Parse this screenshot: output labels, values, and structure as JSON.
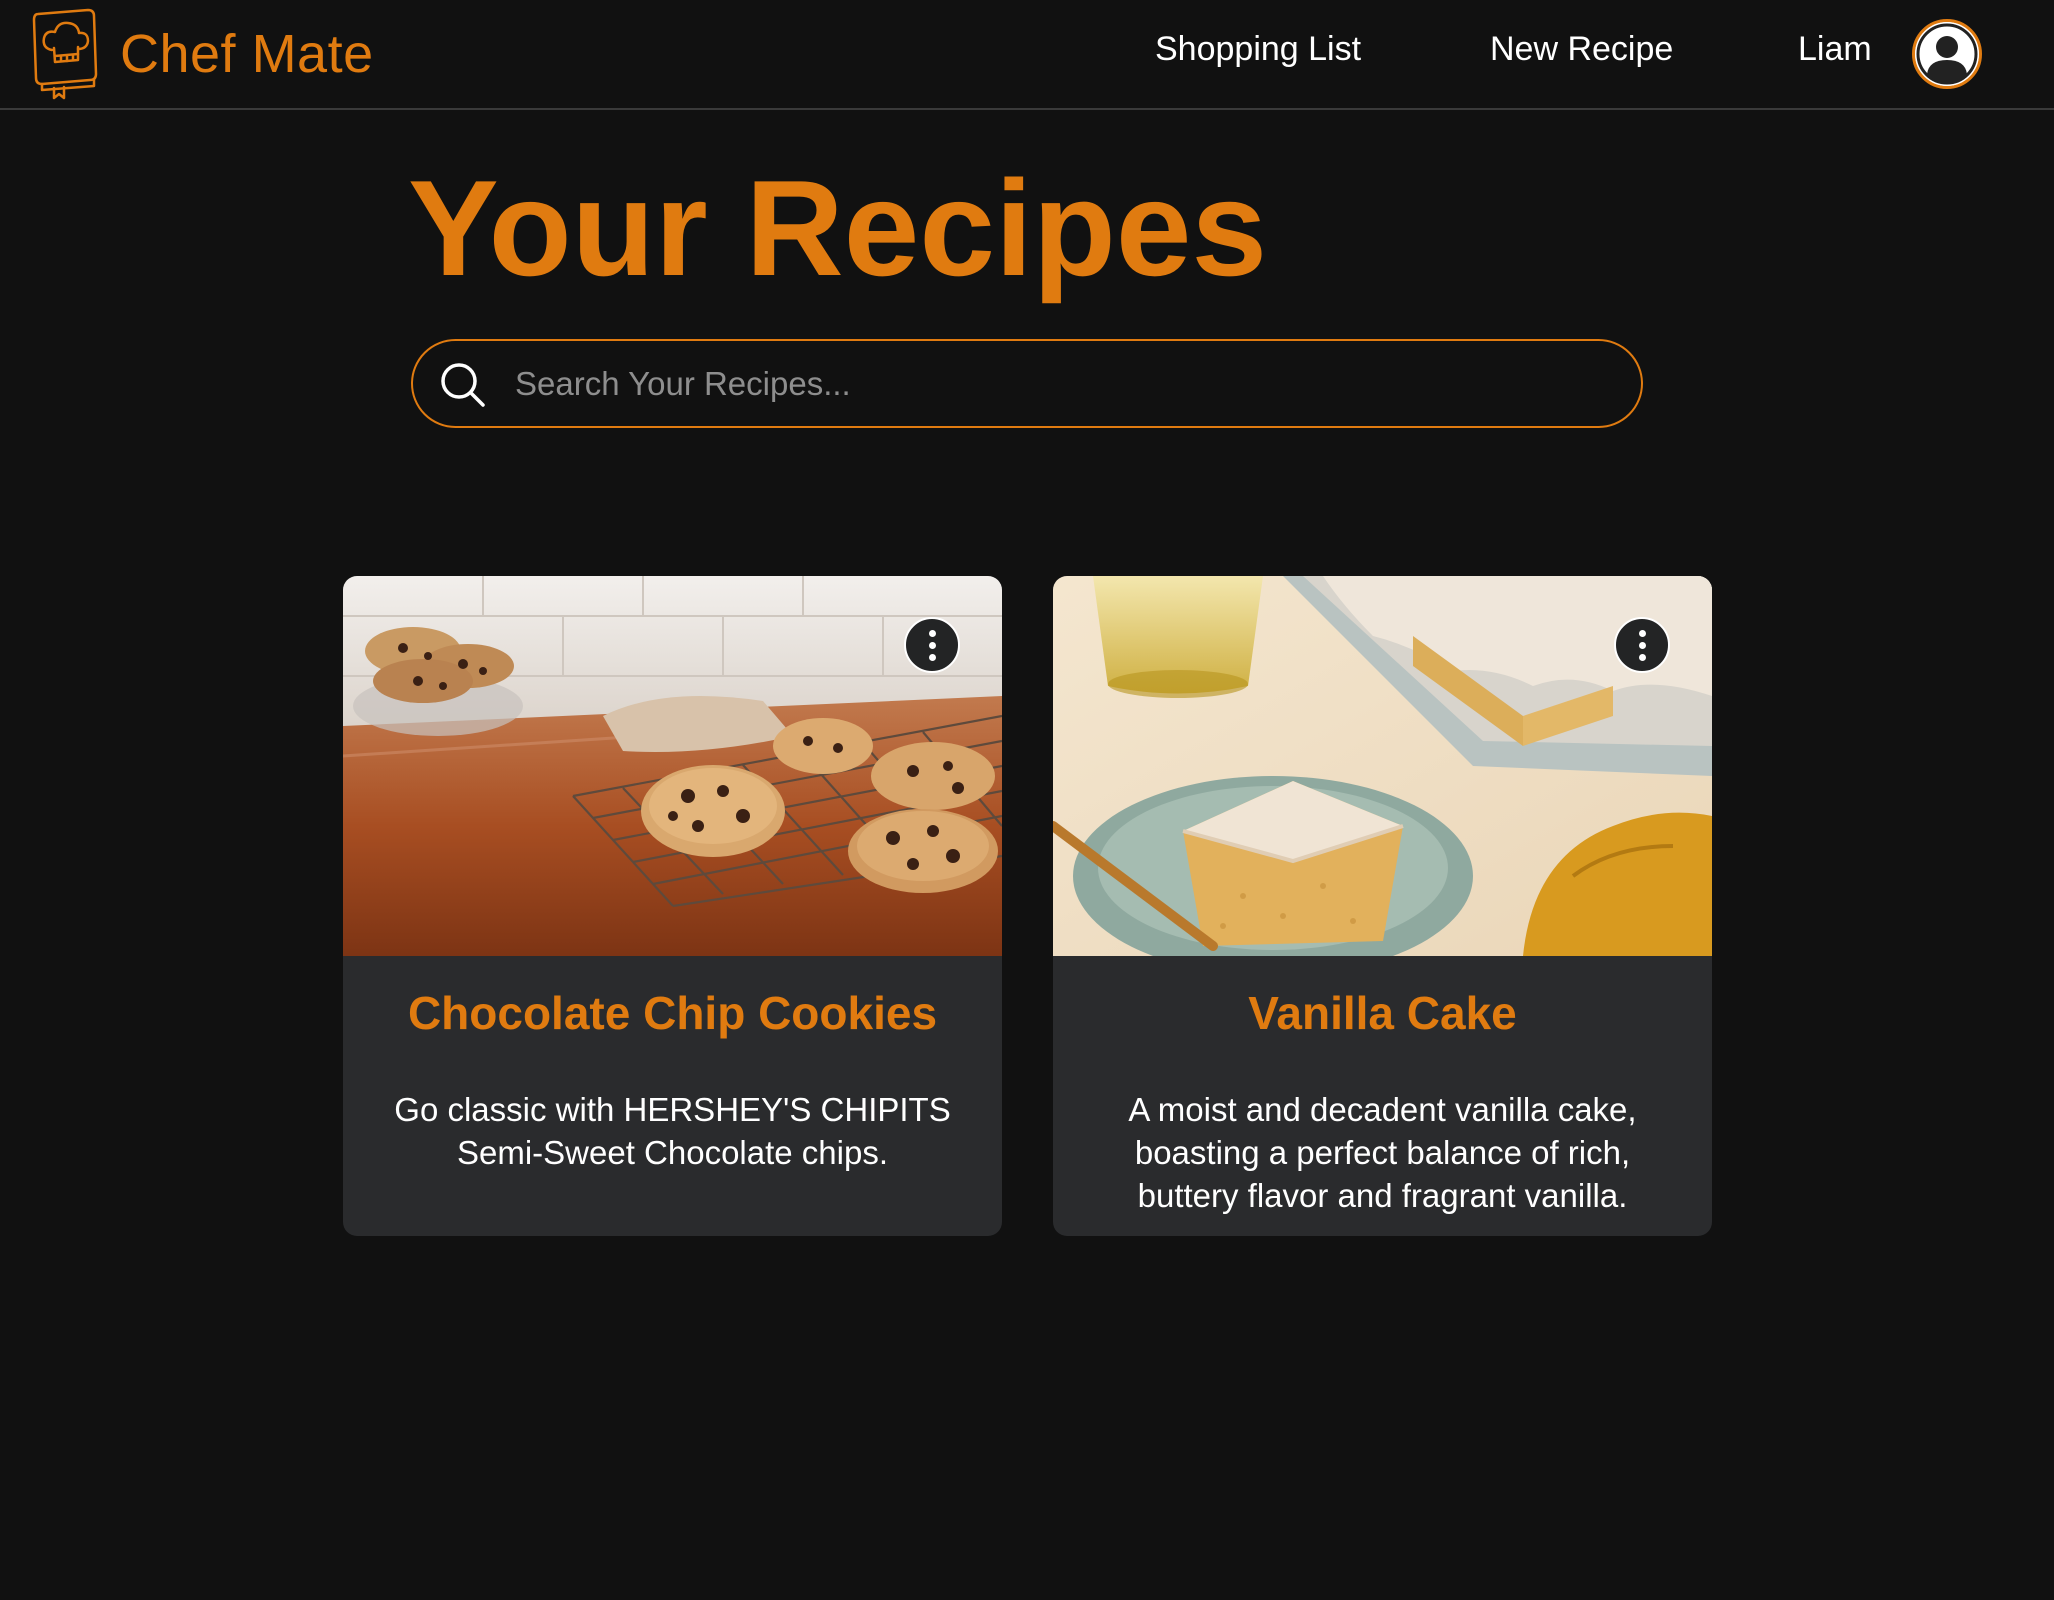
{
  "colors": {
    "accent": "#e07b10",
    "background": "#111111",
    "card": "#2a2b2d",
    "text": "#ffffff"
  },
  "navbar": {
    "brand": "Chef Mate",
    "brand_icon": "chef-cookbook-icon",
    "links": {
      "shopping_list": "Shopping List",
      "new_recipe": "New Recipe"
    },
    "user_name": "Liam",
    "avatar_icon": "user-avatar-icon"
  },
  "main": {
    "title": "Your Recipes",
    "search": {
      "placeholder": "Search Your Recipes...",
      "value": "",
      "icon": "search-icon"
    },
    "recipes": [
      {
        "title": "Chocolate Chip Cookies",
        "description": "Go classic with HERSHEY'S CHIPITS Semi-Sweet Chocolate chips.",
        "image": "chocolate-chip-cookies-photo",
        "menu_icon": "more-vertical-icon"
      },
      {
        "title": "Vanilla Cake",
        "description": "A moist and decadent vanilla cake, boasting a perfect balance of rich, buttery flavor and fragrant vanilla.",
        "image": "vanilla-cake-photo",
        "menu_icon": "more-vertical-icon"
      }
    ]
  }
}
